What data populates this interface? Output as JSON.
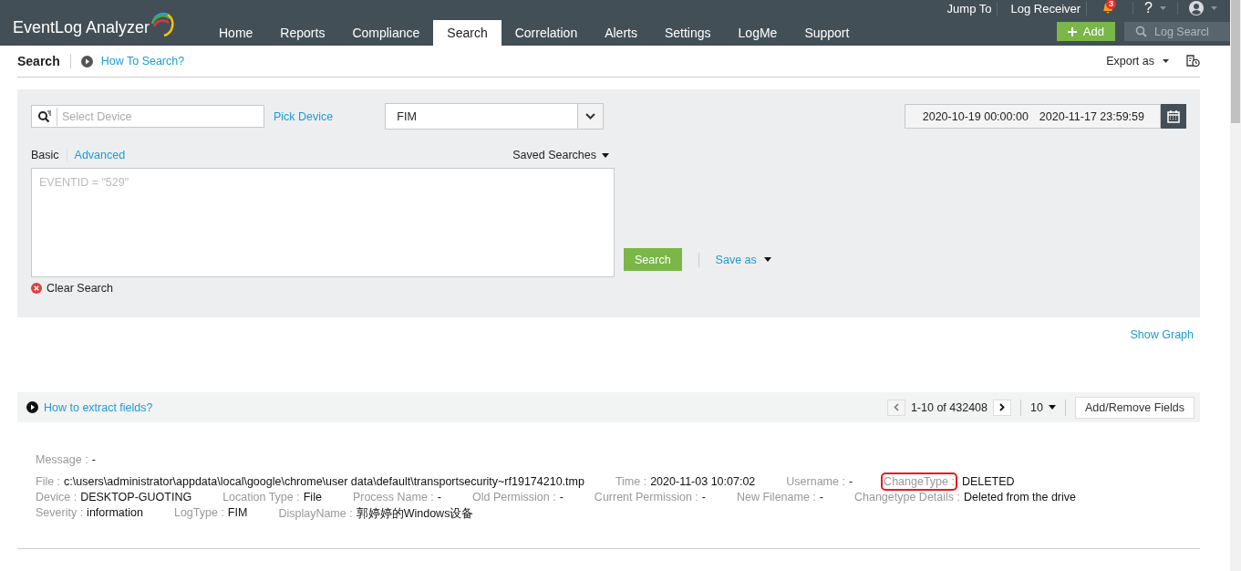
{
  "header": {
    "logo": "EventLog Analyzer",
    "nav": [
      {
        "label": "Home",
        "selected": false
      },
      {
        "label": "Reports",
        "selected": false
      },
      {
        "label": "Compliance",
        "selected": false
      },
      {
        "label": "Search",
        "selected": true
      },
      {
        "label": "Correlation",
        "selected": false
      },
      {
        "label": "Alerts",
        "selected": false
      },
      {
        "label": "Settings",
        "selected": false
      },
      {
        "label": "LogMe",
        "selected": false
      },
      {
        "label": "Support",
        "selected": false
      }
    ],
    "top_links": [
      "Jump To",
      "Log Receiver"
    ],
    "notification_count": "3",
    "help": "?",
    "add_button": "Add",
    "search": {
      "placeholder": "Log Searcl"
    }
  },
  "page": {
    "title": "Search",
    "help_link": "How To Search?",
    "export": "Export as"
  },
  "search_panel": {
    "device_field": {
      "placeholder": "Select Device"
    },
    "pick_device": "Pick Device",
    "log_type": "FIM",
    "date_from": "2020-10-19 00:00:00",
    "date_to": "2020-11-17 23:59:59",
    "modes": [
      {
        "label": "Basic",
        "selected": true
      },
      {
        "label": "Advanced",
        "selected": false
      }
    ],
    "saved_searches": "Saved Searches",
    "query": {
      "placeholder": "EVENTID = \"529\""
    },
    "search_button": "Search",
    "save_as": "Save as",
    "clear": "Clear Search"
  },
  "show_graph": "Show Graph",
  "results_bar": {
    "help_link": "How to extract fields?",
    "range": "1-10 of 432408",
    "page_size": "10",
    "fields_button": "Add/Remove Fields"
  },
  "record": {
    "message": {
      "label": "Message :",
      "value": "-"
    },
    "rows": [
      {
        "fields": [
          {
            "label": "File :",
            "value": "c:\\users\\administrator\\appdata\\local\\google\\chrome\\user data\\default\\transportsecurity~rf19174210.tmp",
            "highlighted": false
          },
          {
            "label": "Time :",
            "value": "2020-11-03 10:07:02",
            "highlighted": false
          },
          {
            "label": "Username :",
            "value": "-",
            "highlighted": false
          },
          {
            "label": "ChangeType :",
            "value": "DELETED",
            "highlighted": true
          }
        ]
      },
      {
        "fields": [
          {
            "label": "Device :",
            "value": "DESKTOP-GUOTING",
            "highlighted": false
          },
          {
            "label": "Location Type :",
            "value": "File",
            "highlighted": false
          },
          {
            "label": "Process Name :",
            "value": "-",
            "highlighted": false
          },
          {
            "label": "Old Permission :",
            "value": "-",
            "highlighted": false
          },
          {
            "label": "Current Permission :",
            "value": "-",
            "highlighted": false
          },
          {
            "label": "New Filename :",
            "value": "-",
            "highlighted": false
          },
          {
            "label": "Changetype Details :",
            "value": "Deleted from the drive",
            "highlighted": false
          }
        ]
      },
      {
        "fields": [
          {
            "label": "Severity :",
            "value": "information",
            "highlighted": false
          },
          {
            "label": "LogType :",
            "value": "FIM",
            "highlighted": false
          },
          {
            "label": "DisplayName :",
            "value": "郭婷婷的Windows设备",
            "highlighted": false
          }
        ]
      }
    ]
  }
}
